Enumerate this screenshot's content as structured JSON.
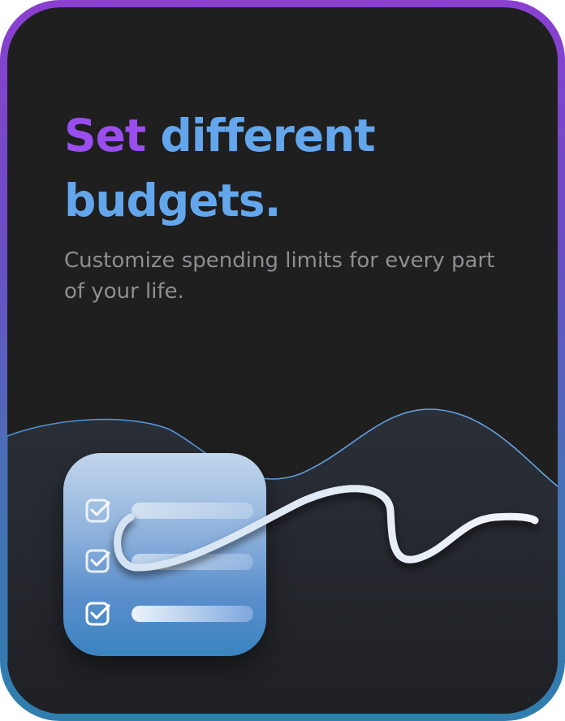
{
  "hero": {
    "title_accent": "Set",
    "title_rest": "different budgets.",
    "subtitle": "Customize spending limits for every part of your life."
  },
  "illustration": {
    "icon": "budget-checklist-icon",
    "rows": [
      {
        "icon": "checkbox-checked-icon"
      },
      {
        "icon": "checkbox-checked-icon"
      },
      {
        "icon": "checkbox-checked-icon"
      }
    ]
  },
  "colors": {
    "accent_purple": "#9b4ef0",
    "accent_blue": "#63a6ec",
    "background": "#1f1f20",
    "subtitle": "#8e8e93",
    "frame_top": "#8a3fd1",
    "frame_bottom": "#2f7fae"
  }
}
